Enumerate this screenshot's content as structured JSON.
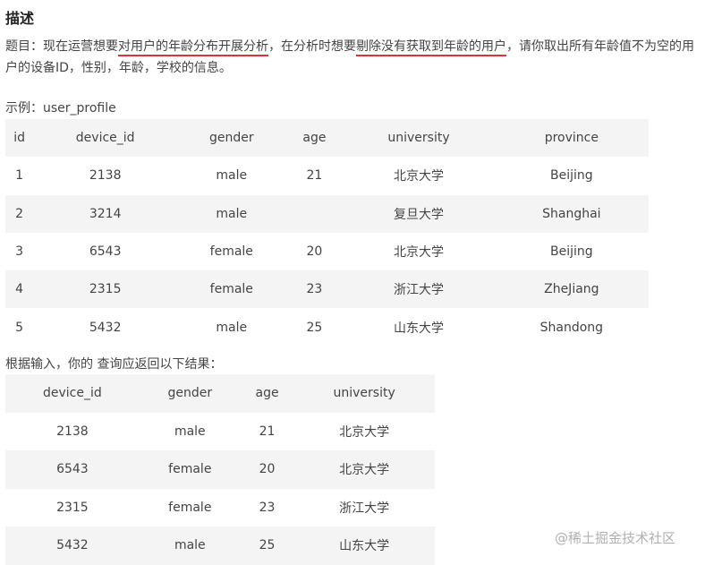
{
  "heading": "描述",
  "description": {
    "p1": "题目：现在运营想要",
    "u1": "对用户的年龄分布开展分析",
    "p2": "，在分析时想要",
    "u2": "剔除没有获取到年龄的用户",
    "p3": "，请你取出所有年龄值不为空的用户的设备ID，性别，年龄，学校的信息。"
  },
  "example_label": "示例：user_profile",
  "table1": {
    "headers": [
      "id",
      "device_id",
      "gender",
      "age",
      "university",
      "province"
    ],
    "rows": [
      [
        "1",
        "2138",
        "male",
        "21",
        "北京大学",
        "Beijing"
      ],
      [
        "2",
        "3214",
        "male",
        "",
        "复旦大学",
        "Shanghai"
      ],
      [
        "3",
        "6543",
        "female",
        "20",
        "北京大学",
        "Beijing"
      ],
      [
        "4",
        "2315",
        "female",
        "23",
        "浙江大学",
        "ZheJiang"
      ],
      [
        "5",
        "5432",
        "male",
        "25",
        "山东大学",
        "Shandong"
      ]
    ]
  },
  "result_label": "根据输入，你的 查询应返回以下结果：",
  "table2": {
    "headers": [
      "device_id",
      "gender",
      "age",
      "university"
    ],
    "rows": [
      [
        "2138",
        "male",
        "21",
        "北京大学"
      ],
      [
        "6543",
        "female",
        "20",
        "北京大学"
      ],
      [
        "2315",
        "female",
        "23",
        "浙江大学"
      ],
      [
        "5432",
        "male",
        "25",
        "山东大学"
      ]
    ]
  },
  "watermark": "@稀土掘金技术社区",
  "colors": {
    "underline": "#e0303a",
    "stripe": "#f4f4f5",
    "text": "#444444"
  }
}
